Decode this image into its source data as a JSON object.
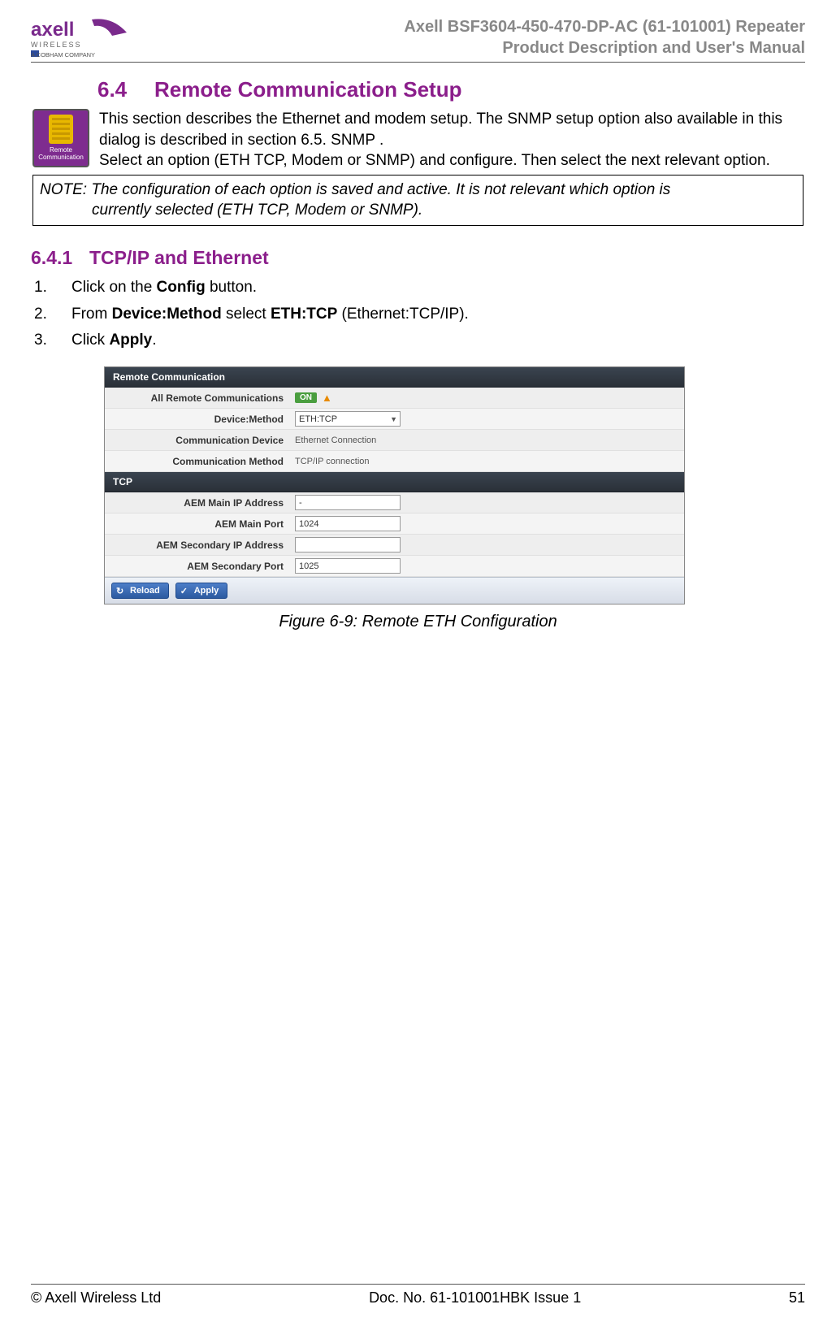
{
  "header": {
    "line1": "Axell BSF3604-450-470-DP-AC (61-101001) Repeater",
    "line2": "Product Description and User's Manual",
    "logo_top": "axell",
    "logo_mid": "WIRELESS",
    "logo_sub": "A COBHAM COMPANY"
  },
  "section": {
    "num": "6.4",
    "title": "Remote Communication Setup",
    "intro": "This section describes the Ethernet and modem setup. The SNMP setup option also available in this dialog is described in section 6.5. SNMP .\nSelect an option (ETH TCP, Modem or SNMP) and configure. Then select the next relevant option.",
    "icon_label": "Remote Communication"
  },
  "note": {
    "prefix": "NOTE: ",
    "body_line1": "The configuration of each option is saved and active. It is not relevant which option is",
    "body_line2": "currently selected (ETH TCP, Modem or SNMP)."
  },
  "subsection": {
    "num": "6.4.1",
    "title": "TCP/IP and Ethernet"
  },
  "steps": [
    {
      "pre": "Click on the ",
      "b": "Config",
      "post": " button."
    },
    {
      "pre": "From ",
      "b": "Device:Method",
      "mid": " select ",
      "b2": "ETH:TCP",
      "post": " (Ethernet:TCP/IP)."
    },
    {
      "pre": "Click ",
      "b": "Apply",
      "post": "."
    }
  ],
  "screenshot": {
    "panel1_title": "Remote Communication",
    "rows1": {
      "all_remote_label": "All Remote Communications",
      "all_remote_badge": "ON",
      "device_method_label": "Device:Method",
      "device_method_value": "ETH:TCP",
      "comm_device_label": "Communication Device",
      "comm_device_value": "Ethernet Connection",
      "comm_method_label": "Communication Method",
      "comm_method_value": "TCP/IP connection"
    },
    "panel2_title": "TCP",
    "rows2": {
      "main_ip_label": "AEM Main IP Address",
      "main_ip_value": "-",
      "main_port_label": "AEM Main Port",
      "main_port_value": "1024",
      "sec_ip_label": "AEM Secondary IP Address",
      "sec_ip_value": "",
      "sec_port_label": "AEM Secondary Port",
      "sec_port_value": "1025"
    },
    "reload_label": "Reload",
    "apply_label": "Apply"
  },
  "figure_caption": "Figure 6-9:  Remote ETH Configuration",
  "footer": {
    "left": "© Axell Wireless Ltd",
    "center": "Doc. No. 61-101001HBK Issue 1",
    "right": "51"
  }
}
